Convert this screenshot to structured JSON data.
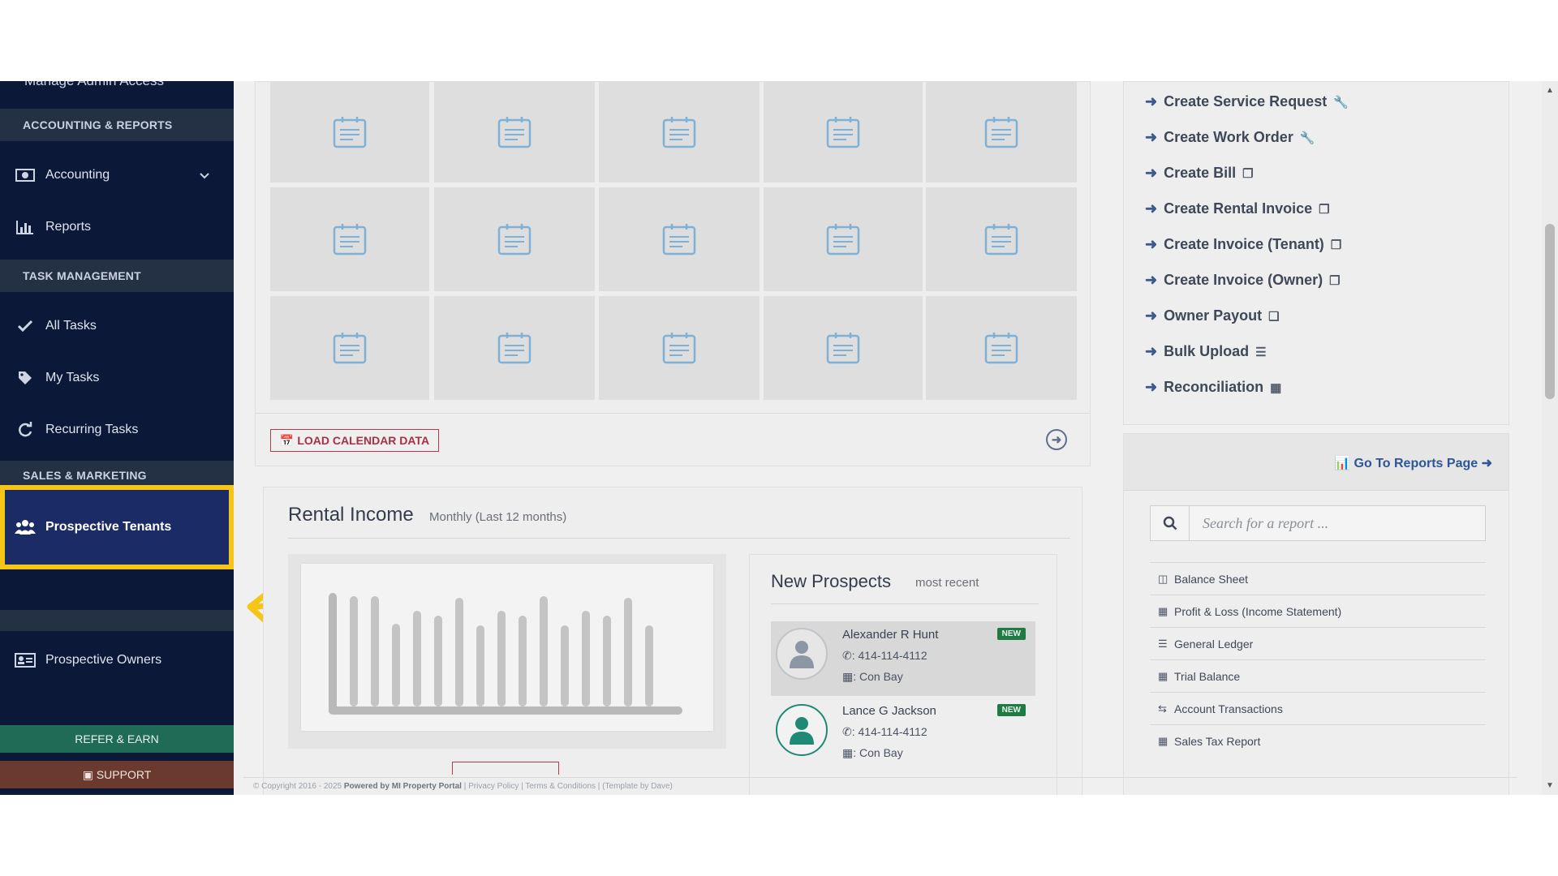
{
  "sidebar": {
    "cut_item": "Manage Admin Access",
    "sections": {
      "accounting": "ACCOUNTING & REPORTS",
      "tasks": "TASK MANAGEMENT",
      "sales": "SALES & MARKETING"
    },
    "items": [
      {
        "label": "Accounting",
        "icon": "money-icon"
      },
      {
        "label": "Reports",
        "icon": "bar-chart-icon"
      },
      {
        "label": "All Tasks",
        "icon": "check-icon"
      },
      {
        "label": "My Tasks",
        "icon": "tag-icon"
      },
      {
        "label": "Recurring Tasks",
        "icon": "refresh-icon"
      },
      {
        "label": "Prospective Tenants",
        "icon": "users-icon",
        "active": true
      },
      {
        "label": "Prospective Owners",
        "icon": "id-card-icon"
      }
    ],
    "refer_label": "REFER & EARN",
    "support_label": "SUPPORT"
  },
  "calendar": {
    "load_label": "LOAD CALENDAR DATA"
  },
  "rental_income": {
    "title": "Rental Income",
    "subtitle": "Monthly (Last 12 months)"
  },
  "prospects": {
    "title": "New Prospects",
    "subtitle": "most recent",
    "items": [
      {
        "name": "Alexander R Hunt",
        "phone": "414-114-4112",
        "location": "Con Bay",
        "badge": "NEW"
      },
      {
        "name": "Lance G Jackson",
        "phone": "414-114-4112",
        "location": "Con Bay",
        "badge": "NEW"
      }
    ]
  },
  "actions": [
    "Create Service Request",
    "Create Work Order",
    "Create Bill",
    "Create Rental Invoice",
    "Create Invoice (Tenant)",
    "Create Invoice (Owner)",
    "Owner Payout",
    "Bulk Upload",
    "Reconciliation"
  ],
  "reports": {
    "go_label": "Go To Reports Page",
    "search_placeholder": "Search for a report ...",
    "items": [
      "Balance Sheet",
      "Profit & Loss (Income Statement)",
      "General Ledger",
      "Trial Balance",
      "Account Transactions",
      "Sales Tax Report"
    ]
  },
  "footer": {
    "copyright": "© Copyright 2016 - 2025",
    "powered": "Powered by MI Property Portal",
    "links": "| Privacy Policy | Terms & Conditions |",
    "template": "(Template by Dave)"
  },
  "colors": {
    "sidebar_bg": "#0c1838",
    "highlight": "#f5c518",
    "refer": "#1f6b55",
    "support": "#6b3a2f"
  }
}
